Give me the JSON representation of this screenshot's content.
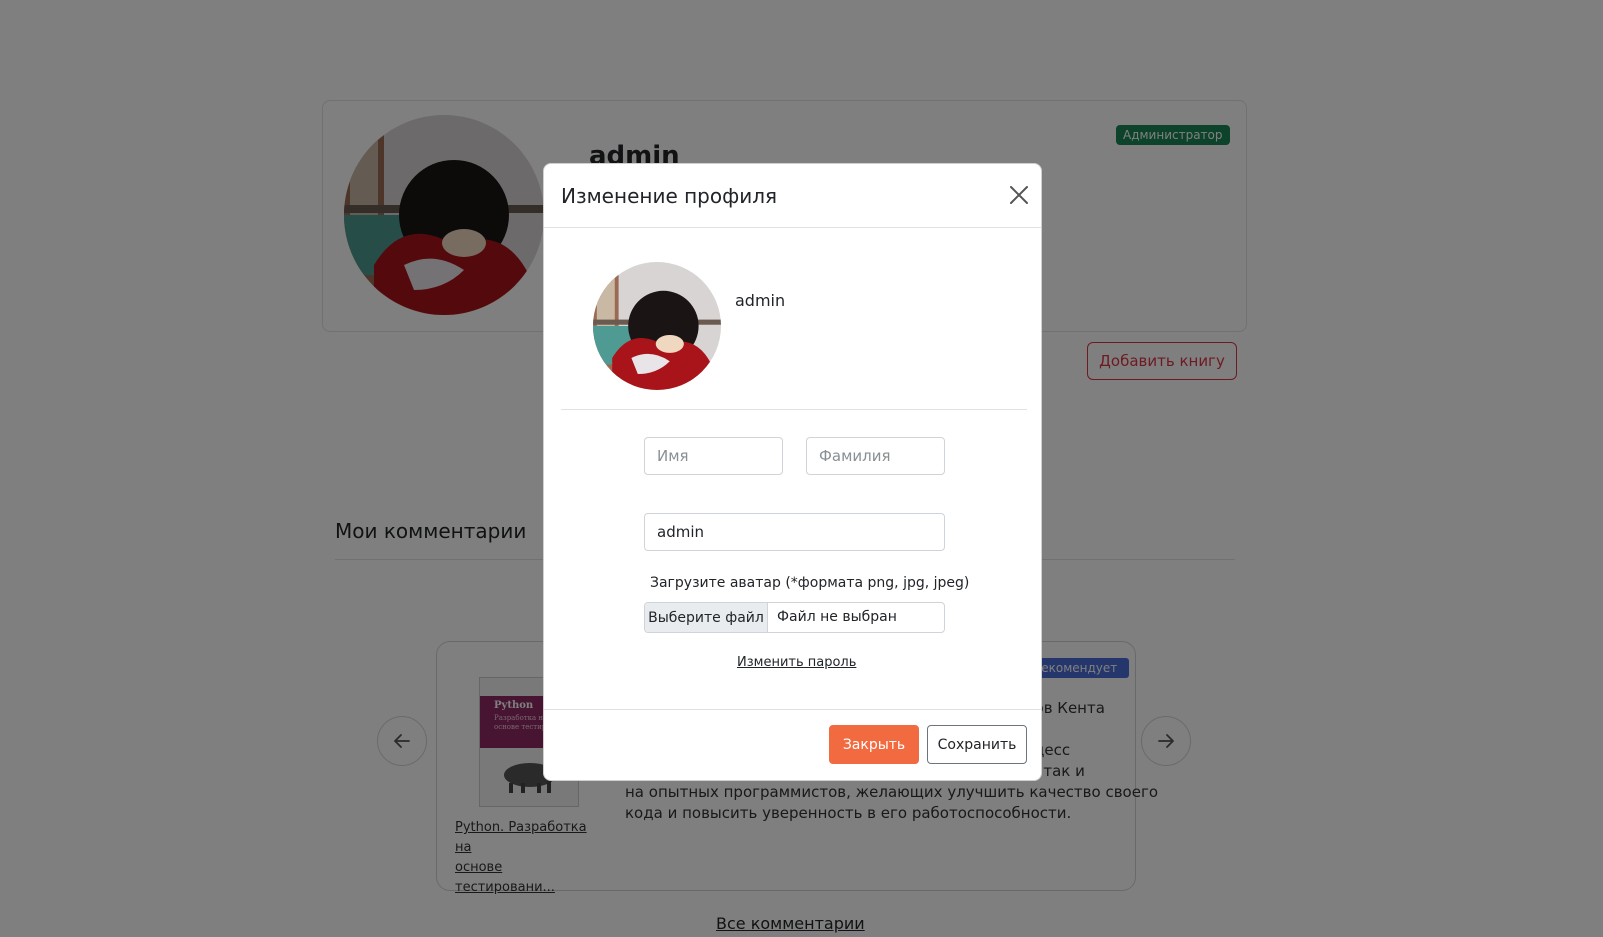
{
  "profile": {
    "username": "admin",
    "role_badge": "Администратор",
    "add_book_label": "Добавить книгу"
  },
  "comments": {
    "title": "Мои комментарии",
    "recommend_badge": "Рекомендует",
    "book_title_line1": "Python. Разработка на",
    "book_title_line2": "основе тестировани...",
    "book_cover_title": "Python",
    "book_cover_subtitle": "Разработка на основе тестирования",
    "text_line1": "ров Кента",
    "text_line2": "оцесс",
    "text_line3": "в, так и",
    "text_line4": "на опытных программистов, желающих улучшить качество своего",
    "text_line5": "кода и повысить уверенность в его работоспособности.",
    "all_comments_link": "Все комментарии"
  },
  "modal": {
    "title": "Изменение профиля",
    "username": "admin",
    "first_name_placeholder": "Имя",
    "last_name_placeholder": "Фамилия",
    "login_value": "admin",
    "upload_label": "Загрузите аватар (*формата png, jpg, jpeg)",
    "file_button_label": "Выберите файл",
    "file_status": "Файл не выбран",
    "change_password_link": "Изменить пароль",
    "close_button_label": "Закрыть",
    "save_button_label": "Сохранить"
  },
  "icons": {
    "close": "close-icon",
    "prev": "arrow-left-icon",
    "next": "arrow-right-icon"
  },
  "colors": {
    "accent": "#f26a3f",
    "role_badge": "#198754",
    "danger": "#dc3545",
    "recommend_badge": "#4b6cd9"
  }
}
